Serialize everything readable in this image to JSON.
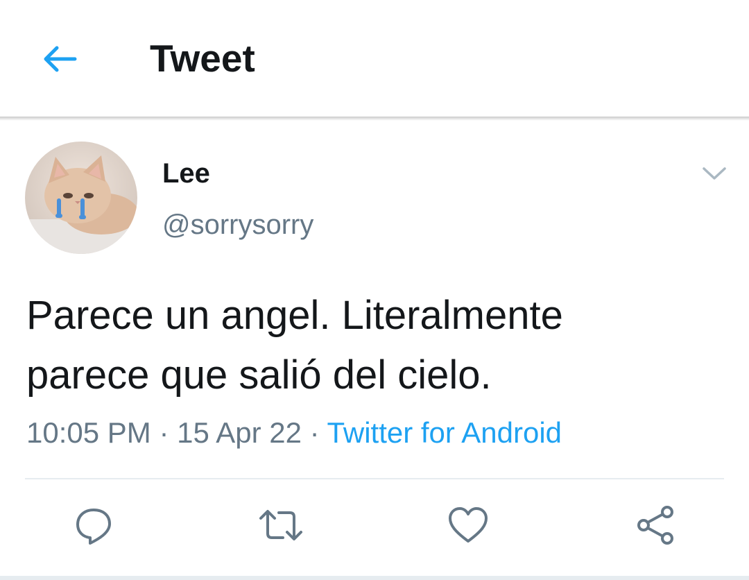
{
  "header": {
    "title": "Tweet",
    "accent_color": "#1da1f2"
  },
  "tweet": {
    "author_name": "Lee",
    "author_handle": "@sorrysorry",
    "text_line1": "Parece un angel. Literalmente",
    "text_line2": "parece que salió del cielo.",
    "time": "10:05 PM",
    "date": "15 Apr 22",
    "separator": "·",
    "source": "Twitter for Android"
  },
  "actions": {
    "reply_icon": "reply-icon",
    "retweet_icon": "retweet-icon",
    "like_icon": "heart-icon",
    "share_icon": "share-icon"
  },
  "colors": {
    "text_primary": "#14171a",
    "text_secondary": "#657786",
    "link": "#1da1f2",
    "divider": "#e6ecf0"
  }
}
